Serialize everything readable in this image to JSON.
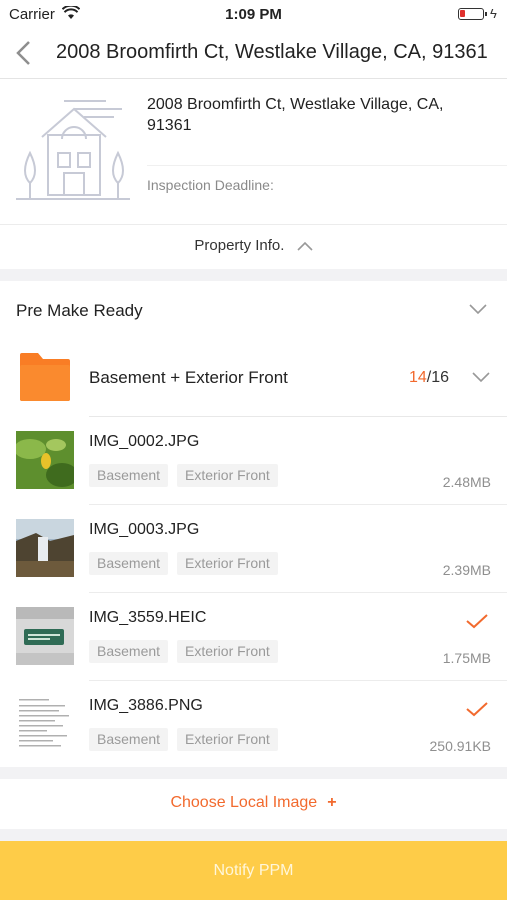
{
  "status_bar": {
    "carrier": "Carrier",
    "time": "1:09 PM",
    "battery_level": 0.25,
    "battery_color": "#e0312e"
  },
  "nav": {
    "title": "2008 Broomfirth Ct, Westlake Village, CA, 91361"
  },
  "property": {
    "address": "2008 Broomfirth Ct, Westlake Village, CA, 91361",
    "deadline_label": "Inspection Deadline:",
    "info_toggle": "Property Info."
  },
  "section": {
    "title": "Pre Make Ready",
    "folder": {
      "name": "Basement + Exterior Front",
      "done": "14",
      "total": "/16"
    }
  },
  "files": [
    {
      "name": "IMG_0002.JPG",
      "tags": [
        "Basement",
        "Exterior Front"
      ],
      "size": "2.48MB",
      "checked": false
    },
    {
      "name": "IMG_0003.JPG",
      "tags": [
        "Basement",
        "Exterior Front"
      ],
      "size": "2.39MB",
      "checked": false
    },
    {
      "name": "IMG_3559.HEIC",
      "tags": [
        "Basement",
        "Exterior Front"
      ],
      "size": "1.75MB",
      "checked": true
    },
    {
      "name": "IMG_3886.PNG",
      "tags": [
        "Basement",
        "Exterior Front"
      ],
      "size": "250.91KB",
      "checked": true
    }
  ],
  "actions": {
    "choose_label": "Choose Local Image",
    "choose_plus": "+",
    "notify_label": "Notify PPM"
  },
  "colors": {
    "accent": "#f26a2e",
    "notify_bg": "#fecc48",
    "folder": "#f97d25"
  }
}
